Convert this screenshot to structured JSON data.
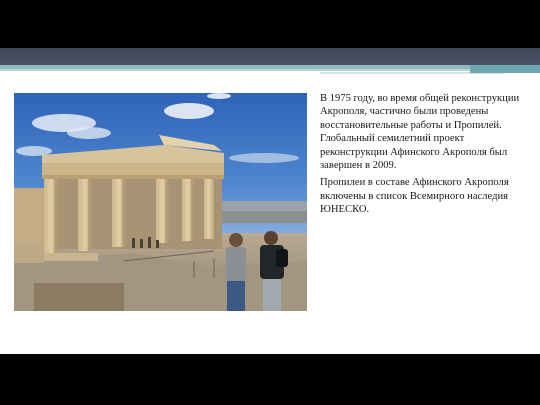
{
  "paragraphs": [
    "В 1975 году, во время общей реконструкции Акрополя, частично были проведены восстановительные работы и Пропилей. Глобальный семилетний проект реконструкции Афинского Акрополя был завершен в 2009.",
    "Пропилеи в составе Афинского Акрополя включены в список Всемирного наследия ЮНЕСКО."
  ],
  "colors": {
    "background": "#000000",
    "slide": "#ffffff",
    "header_band": "#4a5264",
    "accent_teal": "#8fb9bf",
    "text": "#1a1a1a"
  },
  "photo": {
    "subject": "Propylaea of the Athenian Acropolis with visitors"
  }
}
